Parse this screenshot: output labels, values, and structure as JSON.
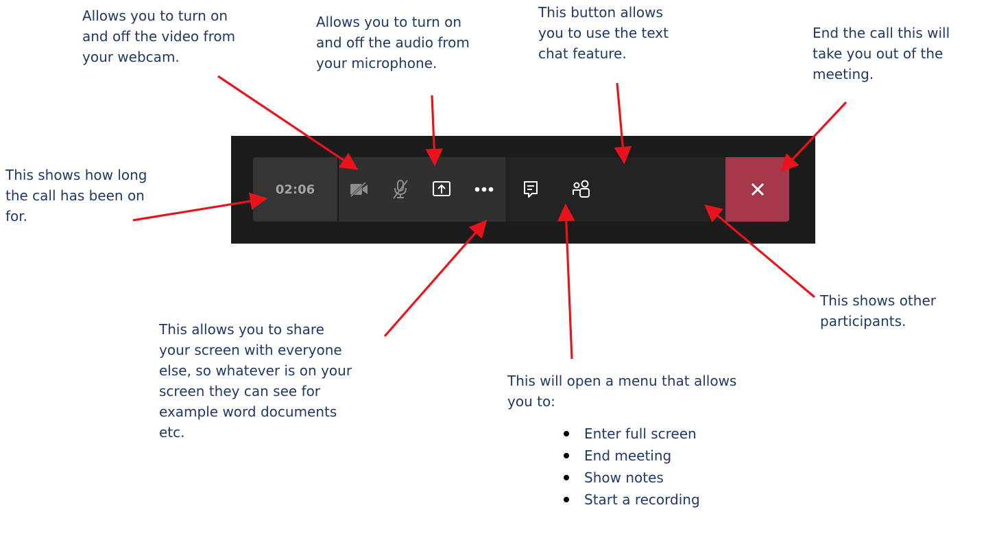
{
  "toolbar": {
    "timer": "02:06",
    "buttons": [
      {
        "name": "camera-off",
        "icon": "video-off-icon"
      },
      {
        "name": "mic-off",
        "icon": "mic-off-icon"
      },
      {
        "name": "share",
        "icon": "share-screen-icon"
      },
      {
        "name": "more",
        "icon": "more-dots-icon"
      },
      {
        "name": "chat",
        "icon": "chat-icon"
      },
      {
        "name": "participants",
        "icon": "people-icon"
      },
      {
        "name": "hang-up",
        "icon": "close-icon"
      }
    ],
    "colors": {
      "hang_up": "#a4374a",
      "bar": "#2b2b2b",
      "annotation_text": "#1f3864",
      "arrow": "#e8141c"
    }
  },
  "annotations": {
    "timer": [
      "This shows how long",
      "the call has been on",
      "for."
    ],
    "video": [
      "Allows you to turn on",
      "and off the video from",
      "your webcam."
    ],
    "audio": [
      "Allows you to turn on",
      "and off the audio from",
      "your microphone."
    ],
    "chat": [
      "This button allows",
      "you to use the text",
      "chat feature."
    ],
    "end": [
      "End the call this will",
      "take you out of the",
      "meeting."
    ],
    "share": [
      "This allows you to share",
      "your screen with everyone",
      "else, so whatever is on your",
      "screen they can see for",
      "example word documents",
      "etc."
    ],
    "participants": [
      "This shows other",
      "participants."
    ],
    "more": {
      "lines": [
        "This will open a menu that allows",
        "you to:"
      ],
      "items": [
        "Enter full screen",
        "End meeting",
        "Show notes",
        "Start a recording"
      ]
    }
  }
}
